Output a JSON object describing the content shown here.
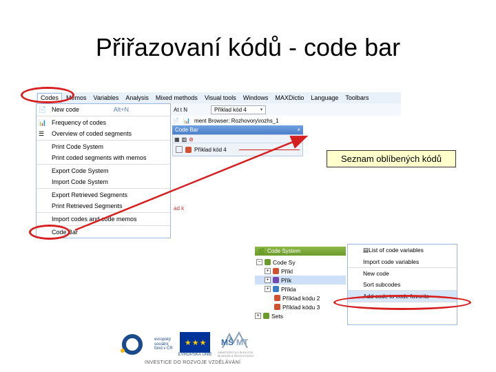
{
  "title": "Přiřazovaní kódů - code bar",
  "menubar": {
    "codes": "Codes",
    "memos": "Memos",
    "variables": "Variables",
    "analysis": "Analysis",
    "mixed": "Mixed methods",
    "visual": "Visual tools",
    "windows": "Windows",
    "maxdictio": "MAXDictio",
    "language": "Language",
    "toolbars": "Toolbars"
  },
  "toolbar": {
    "combo_value": "Příklad kód 4",
    "attn": "At t N"
  },
  "subtoolbar": {
    "label": "ment Browser: Rozhovory\\rozhs_1"
  },
  "docbrowser": {
    "title": "Code Bar",
    "close": "×",
    "item": "Příklad kód 4"
  },
  "menu": {
    "items": [
      "New code",
      "Frequency of codes",
      "Overview of coded segments",
      "Print Code System",
      "Print coded segments with memos",
      "Export Code System",
      "Import Code System",
      "Export Retrieved Segments",
      "Print Retrieved Segments",
      "Import codes and code memos",
      "Code Bar"
    ],
    "shortcut0": "Alt+N"
  },
  "callout": "Seznam oblíbených kódů",
  "tree": {
    "header": "Code System",
    "root": "Code Sy",
    "items": [
      "Příkl",
      "Přík",
      "Příkla",
      "Příklad kódu 2",
      "Příklad kódu 3",
      "Sets"
    ]
  },
  "cmenu": {
    "items": [
      "List of code variables",
      "Import code variables",
      "New code",
      "Sort subcodes",
      "Add code to code favorits",
      "",
      "",
      ""
    ]
  },
  "logos": {
    "esf_line1": "evropský",
    "esf_line2": "sociální",
    "esf_line3": "fond v ČR",
    "eu": "EVROPSKÁ UNIE",
    "msmt": "MINISTERSTVO ŠKOLSTVÍ,",
    "msmt2": "MLÁDEŽE A TĚLOVÝCHOVY"
  },
  "caption": "INVESTICE DO ROZVOJE VZDĚLÁVÁNÍ"
}
